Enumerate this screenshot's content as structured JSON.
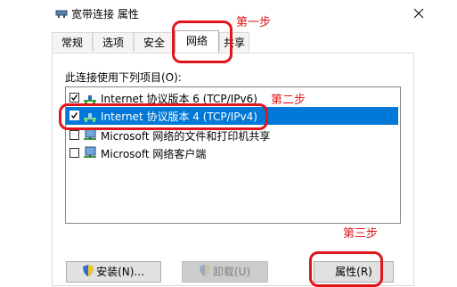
{
  "window": {
    "title": "宽带连接 属性",
    "icon": "network-adapter-icon",
    "close": "close-icon"
  },
  "tabs": [
    {
      "label": "常规",
      "active": false
    },
    {
      "label": "选项",
      "active": false
    },
    {
      "label": "安全",
      "active": false
    },
    {
      "label": "网络",
      "active": true
    },
    {
      "label": "共享",
      "active": false
    }
  ],
  "panel": {
    "connect_label": "此连接使用下列项目(O):"
  },
  "items": [
    {
      "label": "Internet 协议版本 6 (TCP/IPv6)",
      "checked": true,
      "selected": false,
      "icon": "protocol-icon"
    },
    {
      "label": "Internet 协议版本 4 (TCP/IPv4)",
      "checked": true,
      "selected": true,
      "icon": "protocol-icon"
    },
    {
      "label": "Microsoft 网络的文件和打印机共享",
      "checked": false,
      "selected": false,
      "icon": "network-service-icon"
    },
    {
      "label": "Microsoft 网络客户端",
      "checked": false,
      "selected": false,
      "icon": "network-client-icon"
    }
  ],
  "buttons": {
    "install": "安装(N)...",
    "uninstall": "卸载(U)",
    "properties": "属性(R)"
  },
  "annotations": {
    "step1": "第一步",
    "step2": "第二步",
    "step3": "第三步",
    "color": "#e0161b"
  },
  "colors": {
    "selection": "#0078d7"
  }
}
